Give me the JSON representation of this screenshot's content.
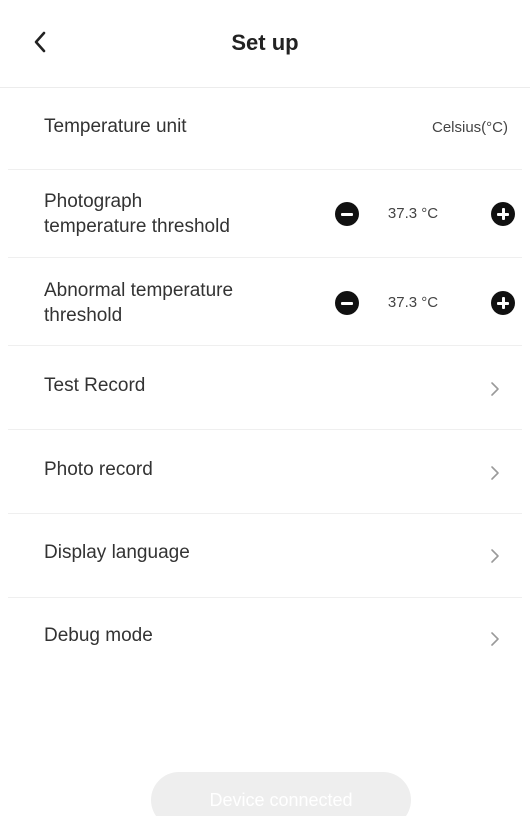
{
  "header": {
    "title": "Set up",
    "back_icon": "chevron-left-icon"
  },
  "settings": {
    "temperature_unit": {
      "label": "Temperature unit",
      "value": "Celsius(°C)"
    },
    "photograph_threshold": {
      "label_line1": "Photograph",
      "label_line2": "temperature threshold",
      "value": "37.3 °C",
      "minus_icon": "minus-circle-icon",
      "plus_icon": "plus-circle-icon"
    },
    "abnormal_threshold": {
      "label_line1": "Abnormal temperature",
      "label_line2": "threshold",
      "value": "37.3 °C",
      "minus_icon": "minus-circle-icon",
      "plus_icon": "plus-circle-icon"
    },
    "nav_items": [
      {
        "label": "Test Record",
        "icon": "chevron-right-icon"
      },
      {
        "label": "Photo record",
        "icon": "chevron-right-icon"
      },
      {
        "label": "Display language",
        "icon": "chevron-right-icon"
      },
      {
        "label": "Debug mode",
        "icon": "chevron-right-icon"
      }
    ]
  },
  "footer": {
    "status_button_label": "Device connected"
  }
}
